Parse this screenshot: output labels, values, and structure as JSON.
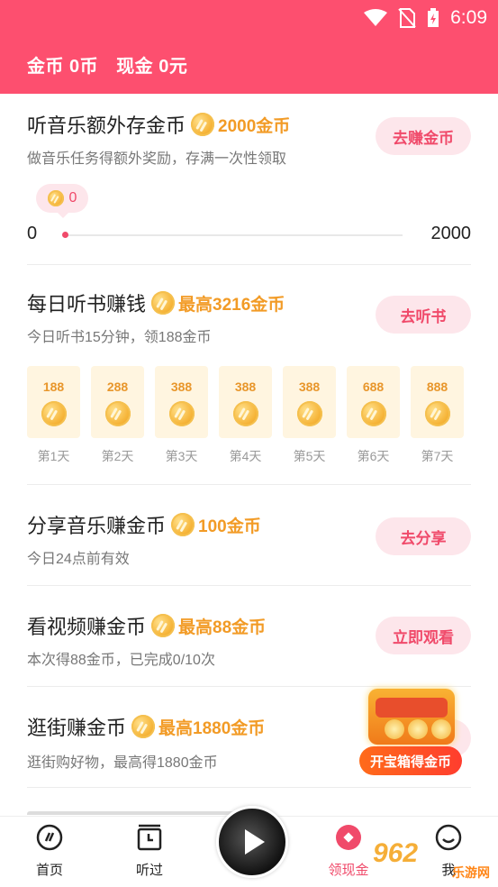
{
  "status_bar": {
    "time": "6:09",
    "icons": [
      "wifi-icon",
      "no-sim-icon",
      "battery-charging-icon"
    ]
  },
  "header": {
    "coins": "金币 0币",
    "cash": "现金 0元"
  },
  "colors": {
    "accent": "#fd4f6f",
    "reward": "#f29b26",
    "pill_bg": "#fde6eb",
    "pill_text": "#f04a6a"
  },
  "tasks": [
    {
      "title": "听音乐额外存金币",
      "reward": "2000金币",
      "desc": "做音乐任务得额外奖励，存满一次性领取",
      "button": "去赚金币",
      "progress": {
        "current": "0",
        "min": "0",
        "max": "2000",
        "value": 0
      }
    },
    {
      "title": "每日听书赚钱",
      "reward": "最高3216金币",
      "desc": "今日听书15分钟，领188金币",
      "button": "去听书",
      "days": [
        {
          "value": "188",
          "label": "第1天"
        },
        {
          "value": "288",
          "label": "第2天"
        },
        {
          "value": "388",
          "label": "第3天"
        },
        {
          "value": "388",
          "label": "第4天"
        },
        {
          "value": "388",
          "label": "第5天"
        },
        {
          "value": "688",
          "label": "第6天"
        },
        {
          "value": "888",
          "label": "第7天"
        }
      ]
    },
    {
      "title": "分享音乐赚金币",
      "reward": "100金币",
      "desc": "今日24点前有效",
      "button": "去分享"
    },
    {
      "title": "看视频赚金币",
      "reward": "最高88金币",
      "desc": "本次得88金币，已完成0/10次",
      "button": "立即观看"
    },
    {
      "title": "逛街赚金币",
      "reward": "最高1880金币",
      "desc": "逛街购好物，最高得1880金币",
      "button": ""
    }
  ],
  "treasure": {
    "label": "开宝箱得金币"
  },
  "bottom_nav": [
    {
      "label": "首页",
      "icon": "home-disc-icon"
    },
    {
      "label": "听过",
      "icon": "history-calendar-icon"
    },
    {
      "label": "",
      "icon": "play-icon"
    },
    {
      "label": "领现金",
      "icon": "cash-diamond-icon",
      "active": true
    },
    {
      "label": "我",
      "icon": "profile-icon"
    }
  ],
  "watermark": {
    "text": "962",
    "sub": "乐游网"
  }
}
